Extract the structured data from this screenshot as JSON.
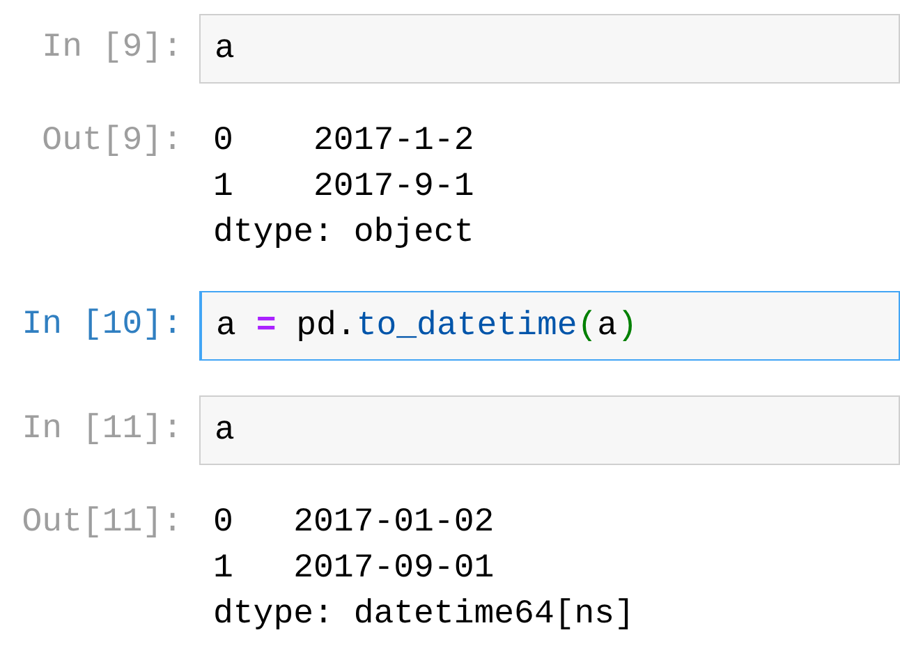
{
  "cells": [
    {
      "kind": "input",
      "prompt": "In [9]:",
      "selected": false,
      "tokens": [
        {
          "text": "a",
          "kind": "name"
        }
      ]
    },
    {
      "kind": "output",
      "prompt": "Out[9]:",
      "lines": [
        "0    2017-1-2",
        "1    2017-9-1",
        "dtype: object"
      ]
    },
    {
      "kind": "input",
      "prompt": "In [10]:",
      "selected": true,
      "tokens": [
        {
          "text": "a ",
          "kind": "name"
        },
        {
          "text": "=",
          "kind": "operator"
        },
        {
          "text": " pd.",
          "kind": "name"
        },
        {
          "text": "to_datetime",
          "kind": "attribute"
        },
        {
          "text": "(",
          "kind": "paren"
        },
        {
          "text": "a",
          "kind": "name"
        },
        {
          "text": ")",
          "kind": "paren"
        }
      ]
    },
    {
      "kind": "input",
      "prompt": "In [11]:",
      "selected": false,
      "tokens": [
        {
          "text": "a",
          "kind": "name"
        }
      ]
    },
    {
      "kind": "output",
      "prompt": "Out[11]:",
      "lines": [
        "0   2017-01-02",
        "1   2017-09-01",
        "dtype: datetime64[ns]"
      ]
    }
  ]
}
